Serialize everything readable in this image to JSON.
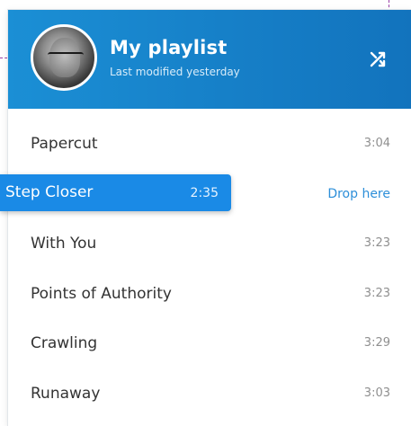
{
  "playlist": {
    "title": "My playlist",
    "subtitle": "Last modified yesterday"
  },
  "icons": {
    "avatar": "user-avatar-photo",
    "shuffle": "shuffle-icon"
  },
  "tracks": [
    {
      "name": "Papercut",
      "duration": "3:04"
    },
    {
      "name": "",
      "duration": "",
      "drop_label": "Drop here"
    },
    {
      "name": "With You",
      "duration": "3:23"
    },
    {
      "name": "Points of Authority",
      "duration": "3:23"
    },
    {
      "name": "Crawling",
      "duration": "3:29"
    },
    {
      "name": "Runaway",
      "duration": "3:03"
    }
  ],
  "dragged_track": {
    "name": "Step Closer",
    "duration": "2:35"
  },
  "colors": {
    "header_start": "#1b8fd5",
    "header_end": "#1273bd",
    "drag_item": "#1a8ae6",
    "drop_label": "#2d8fd9",
    "guide_lines": "#9a3ea7"
  }
}
